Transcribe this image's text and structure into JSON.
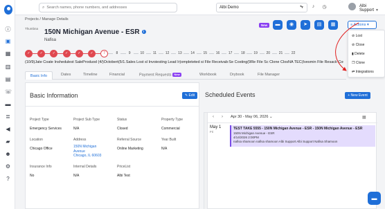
{
  "search": {
    "placeholder": "Search names, phone numbers, and addresses"
  },
  "topbar": {
    "org_name": "Albi Demo",
    "user_name": "Albi Support"
  },
  "breadcrumb": "Projects / Manage Details",
  "header": {
    "image_alt": "Thumbna",
    "title": "150N Michigan Avenue - ESR",
    "subtitle": "Nafisa",
    "new_badge": "New",
    "actions_label": "Actions"
  },
  "actions_menu": [
    "Lost",
    "Close",
    "Delete",
    "Clone",
    "Integrations"
  ],
  "stages": {
    "steps": [
      "✓",
      "✓",
      "✓",
      "✓",
      "✓",
      "✓",
      "7",
      "8",
      "9",
      "10",
      "11",
      "12",
      "13",
      "14",
      "15",
      "16",
      "17",
      "18",
      "19",
      "20",
      "21",
      "22"
    ],
    "labels_text": "(10/9)Jate Coate Inshedulest SaleProduod (4/)Octobert(5/1.Sales  Lost  sl Invoiesting Lead Ir)ompleteted si File Receivab:Se Costing(9Re File Sc Clone ClosNA TEC(Ivesmin File Resack Cout Caoliancesleted I Pu"
  },
  "tabs": [
    "Basic Info",
    "Dates",
    "Timeline",
    "Financial",
    "Payment Requests",
    "Workbook",
    "Drybook",
    "File Manager"
  ],
  "tab_new": "New",
  "basic_info": {
    "title": "Basic Information",
    "edit_label": "Edit",
    "fields": {
      "project_type": {
        "label": "Project Type",
        "value": "Emergency Services"
      },
      "project_sub_type": {
        "label": "Project Sub Type",
        "value": "N/A"
      },
      "status": {
        "label": "Status",
        "value": "Closed"
      },
      "property_type": {
        "label": "Property Type",
        "value": "Commercial"
      },
      "location": {
        "label": "Location",
        "value": "Chicago Office"
      },
      "address": {
        "label": "Address",
        "line1": "150N Michigan",
        "line2": "Avenue",
        "line3": "Chicago, IL 60603"
      },
      "referral_source": {
        "label": "Referral Source",
        "value": "Online Marketing"
      },
      "year_built": {
        "label": "Year Built",
        "value": "N/A"
      },
      "insurance_info": {
        "label": "Insurance Info",
        "value": "No"
      },
      "internal_details": {
        "label": "Internal Details",
        "value": "N/A"
      },
      "pricelist": {
        "label": "PriceList",
        "value": "Albi Test"
      }
    }
  },
  "scheduled_events": {
    "title": "Scheduled Events",
    "new_event_label": "+ New Event",
    "range": "Apr 30 - May 06, 2026",
    "day": "May 1",
    "dow": "Fri",
    "event": {
      "title": "TEST TAKE 5555 - 150N Michigan Avenue - ESR - 150N Michigan Avenue - ESR",
      "line1": "150N Michigan Avenue - ESR",
      "line2": "4/14/2026 2:00PM",
      "line3": "nafisa shamoon nafisa shamoon Albi Support Albi Support Nafisa Shamoon"
    }
  },
  "colors": {
    "accent": "#1f6fd8",
    "stage_done": "#e04850",
    "new_badge": "#8a3ff2",
    "event_bg": "#e4dcfd"
  }
}
